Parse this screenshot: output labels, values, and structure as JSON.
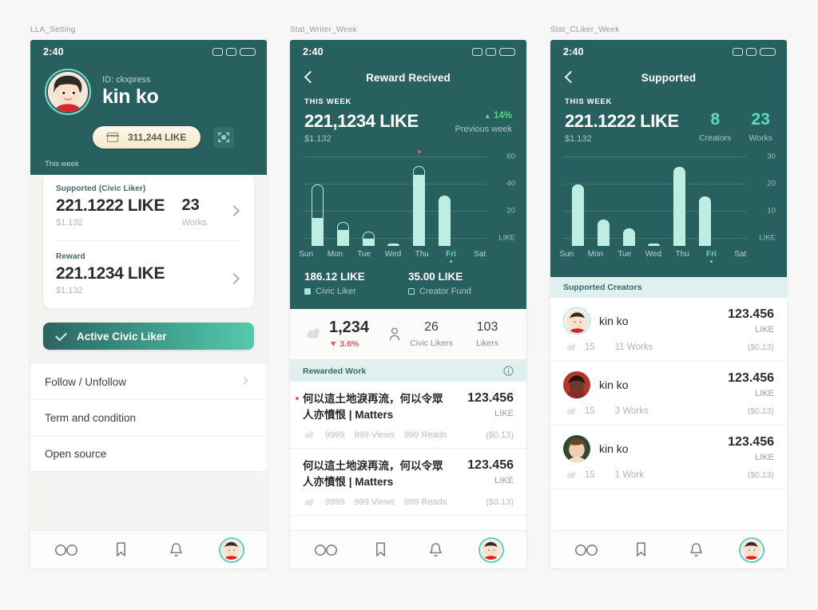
{
  "frames": [
    {
      "label": "LLA_Setting"
    },
    {
      "label": "Stat_Writer_Week"
    },
    {
      "label": "Stat_CLiker_Week"
    }
  ],
  "status": {
    "time": "2:40"
  },
  "phone1": {
    "profile": {
      "id_label": "ID: ckxpress",
      "name": "kin ko"
    },
    "balance_pill": "311,244 LIKE",
    "qr_icon": "qr-scan-icon",
    "section_label": "This week",
    "cards": [
      {
        "label": "Supported (Civic Liker)",
        "amount": "221.1222 LIKE",
        "usd": "$1.132",
        "count": "23",
        "count_label": "Works"
      },
      {
        "label": "Reward",
        "amount": "221.1234 LIKE",
        "usd": "$1.132"
      }
    ],
    "cta": {
      "label": "Active Civic Liker",
      "icon": "check-icon"
    },
    "menu": [
      {
        "label": "Follow / Unfollow",
        "has_chevron": true
      },
      {
        "label": "Term and condition",
        "has_chevron": false
      },
      {
        "label": "Open source",
        "has_chevron": false
      }
    ]
  },
  "phone2": {
    "nav_title": "Reward Recived",
    "kicker": "THIS WEEK",
    "amount": "221,1234 LIKE",
    "usd": "$1.132",
    "delta": "14%",
    "delta_caption": "Previous week",
    "legend": [
      {
        "value": "186.12 LIKE",
        "label": "Civic Liker",
        "style": "fill"
      },
      {
        "value": "35.00 LIKE",
        "label": "Creator Fund",
        "style": "outline"
      }
    ],
    "summary": {
      "likes": "1,234",
      "likes_delta": "3.6%",
      "civic_likers_n": "26",
      "civic_likers_l": "Civic Likers",
      "likers_n": "103",
      "likers_l": "Likers"
    },
    "section_title": "Rewarded Work",
    "section_icon": "info-icon",
    "works": [
      {
        "title": "何以這土地淚再流，何以令眾人亦憤恨 | Matters",
        "amount": "123.456",
        "unit": "LIKE",
        "likes": "9999",
        "views": "999 Views",
        "reads": "999 Reads",
        "usd": "($0.13)",
        "unread": true
      },
      {
        "title": "何以這土地淚再流，何以令眾人亦憤恨 | Matters",
        "amount": "123.456",
        "unit": "LIKE",
        "likes": "9999",
        "views": "999 Views",
        "reads": "999 Reads",
        "usd": "($0.13)",
        "unread": false
      }
    ],
    "chart_data": {
      "type": "bar",
      "title": "Reward Recived — This week",
      "categories": [
        "Sun",
        "Mon",
        "Tue",
        "Wed",
        "Thu",
        "Fri",
        "Sat"
      ],
      "series": [
        {
          "name": "Civic Liker",
          "values": [
            19,
            11,
            5,
            1,
            49,
            34,
            0
          ]
        },
        {
          "name": "Creator Fund",
          "values": [
            23,
            4,
            4,
            0,
            5,
            0,
            0
          ]
        }
      ],
      "totals": [
        42,
        15,
        9,
        1,
        54,
        34,
        0
      ],
      "xlabel": "",
      "ylabel": "LIKE",
      "ylim": [
        0,
        60
      ],
      "yticks": [
        20,
        40,
        60
      ],
      "unit_label": "LIKE",
      "highlight": "Fri",
      "marker": {
        "category": "Thu",
        "color": "#e8594e"
      },
      "grid": true,
      "legend_position": "below"
    }
  },
  "phone3": {
    "nav_title": "Supported",
    "kicker": "THIS WEEK",
    "amount": "221.1222 LIKE",
    "usd": "$1.132",
    "kpis": [
      {
        "value": "8",
        "label": "Creators"
      },
      {
        "value": "23",
        "label": "Works"
      }
    ],
    "section_title": "Supported Creators",
    "creators": [
      {
        "name": "kin ko",
        "amount": "123.456",
        "unit": "LIKE",
        "likes": "15",
        "works": "11 Works",
        "usd": "($0.13)",
        "avatar": "avatar-boy",
        "ring": true
      },
      {
        "name": "kin ko",
        "amount": "123.456",
        "unit": "LIKE",
        "likes": "15",
        "works": "3 Works",
        "usd": "($0.13)",
        "avatar": "avatar-red",
        "ring": false
      },
      {
        "name": "kin ko",
        "amount": "123.456",
        "unit": "LIKE",
        "likes": "15",
        "works": "1 Work",
        "usd": "($0.13)",
        "avatar": "avatar-woman",
        "ring": false
      }
    ],
    "chart_data": {
      "type": "bar",
      "title": "Supported — This week",
      "categories": [
        "Sun",
        "Mon",
        "Tue",
        "Wed",
        "Thu",
        "Fri",
        "Sat"
      ],
      "values": [
        21,
        9,
        6,
        0.5,
        27,
        17,
        0
      ],
      "xlabel": "",
      "ylabel": "LIKE",
      "ylim": [
        0,
        30
      ],
      "yticks": [
        10,
        20,
        30
      ],
      "unit_label": "LIKE",
      "highlight": "Fri",
      "grid": true,
      "series": [
        {
          "name": "Supported",
          "values": [
            21,
            9,
            6,
            0.5,
            27,
            17,
            0
          ]
        }
      ]
    }
  },
  "tabbar": {
    "items": [
      {
        "icon": "glasses-icon",
        "name": "tab-reader"
      },
      {
        "icon": "bookmark-icon",
        "name": "tab-bookmarks"
      },
      {
        "icon": "bell-icon",
        "name": "tab-notifications"
      },
      {
        "icon": "avatar-icon",
        "name": "tab-profile"
      }
    ]
  },
  "colors": {
    "teal": "#28605f",
    "mint": "#bdeee1",
    "accent_green": "#5fd9c0",
    "danger": "#e8594e",
    "gold": "#f7e9c8"
  }
}
